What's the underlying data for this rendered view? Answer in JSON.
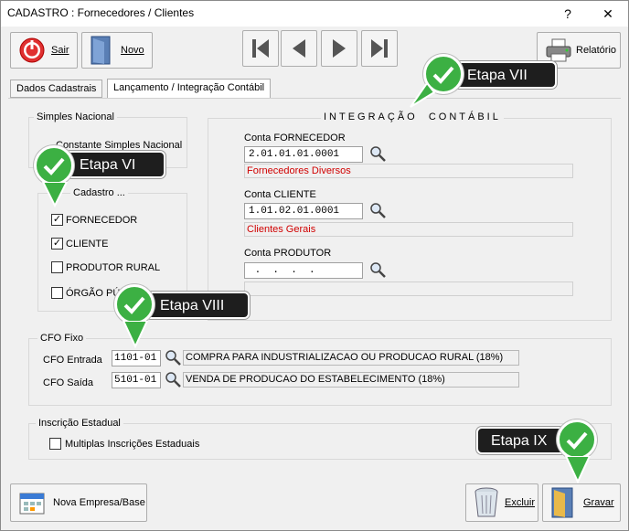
{
  "window": {
    "title": "CADASTRO : Fornecedores / Clientes",
    "help_label": "?",
    "close_label": "✕"
  },
  "toolbar": {
    "exit_label": "Sair",
    "new_label": "Novo",
    "report_label": "Relatório"
  },
  "tabs": [
    {
      "label": "Dados Cadastrais"
    },
    {
      "label": "Lançamento / Integração Contábil"
    }
  ],
  "simples": {
    "title": "Simples Nacional",
    "label": "Constante Simples Nacional"
  },
  "cadastro": {
    "title": "Cadastro ...",
    "items": [
      {
        "label": "FORNECEDOR",
        "checked": true
      },
      {
        "label": "CLIENTE",
        "checked": true
      },
      {
        "label": "PRODUTOR RURAL",
        "checked": false
      },
      {
        "label": "ÓRGÃO PÚ",
        "checked": false
      }
    ]
  },
  "integracao": {
    "title": "INTEGRAÇÃO  CONTÁBIL",
    "fornecedor_label": "Conta FORNECEDOR",
    "fornecedor_value": "2.01.01.01.0001",
    "fornecedor_desc": "Fornecedores Diversos",
    "cliente_label": "Conta CLIENTE",
    "cliente_value": "1.01.02.01.0001",
    "cliente_desc": "Clientes Gerais",
    "produtor_label": "Conta PRODUTOR",
    "produtor_value": " .  .  .  .",
    "produtor_desc": ""
  },
  "cfo": {
    "title": "CFO Fixo",
    "entrada_label": "CFO Entrada",
    "entrada_value": "1101-01",
    "entrada_desc": "COMPRA PARA INDUSTRIALIZACAO OU PRODUCAO RURAL (18%)",
    "saida_label": "CFO Saída",
    "saida_value": "5101-01",
    "saida_desc": "VENDA DE PRODUCAO DO ESTABELECIMENTO (18%)"
  },
  "inscricao": {
    "title": "Inscrição Estadual",
    "multi_label": "Multiplas Inscrições Estaduais",
    "multi_checked": false
  },
  "bottom": {
    "new_company_label": "Nova Empresa/Base",
    "delete_label": "Excluir",
    "save_label": "Gravar"
  },
  "callouts": {
    "vi": "Etapa VI",
    "vii": "Etapa VII",
    "viii": "Etapa VIII",
    "ix": "Etapa IX"
  },
  "colors": {
    "callout_bg": "#1e1e1e",
    "badge_green": "#3cb043",
    "desc_red": "#d00000"
  }
}
